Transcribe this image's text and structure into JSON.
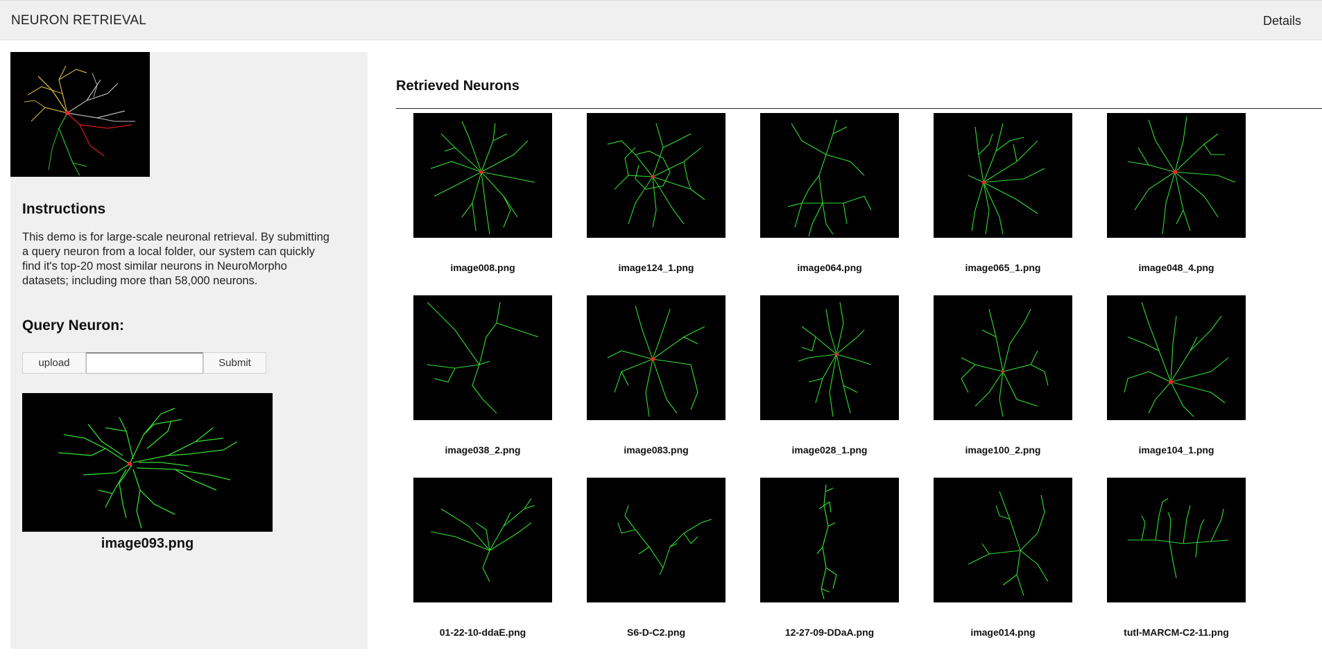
{
  "navbar": {
    "brand": "NEURON RETRIEVAL",
    "details": "Details"
  },
  "sidebar": {
    "instructions_title": "Instructions",
    "instructions_text": "This demo is for large-scale neuronal retrieval. By submitting a query neuron from a local folder, our system can quickly find it's top-20 most similar neurons in NeuroMorpho datasets; including more than 58,000 neurons.",
    "query_title": "Query Neuron:",
    "upload_label": "upload",
    "file_value": "",
    "submit_label": "Submit",
    "query_image_name": "image093.png"
  },
  "results": {
    "title": "Retrieved Neurons",
    "items": [
      "image008.png",
      "image124_1.png",
      "image064.png",
      "image065_1.png",
      "image048_4.png",
      "image038_2.png",
      "image083.png",
      "image028_1.png",
      "image100_2.png",
      "image104_1.png",
      "01-22-10-ddaE.png",
      "S6-D-C2.png",
      "12-27-09-DDaA.png",
      "image014.png",
      "tutl-MARCM-C2-11.png"
    ]
  },
  "colors": {
    "neuron": "#33dd33",
    "soma": "#ff2020",
    "background": "#000000",
    "sidebar_bg": "#f0f0f0"
  }
}
